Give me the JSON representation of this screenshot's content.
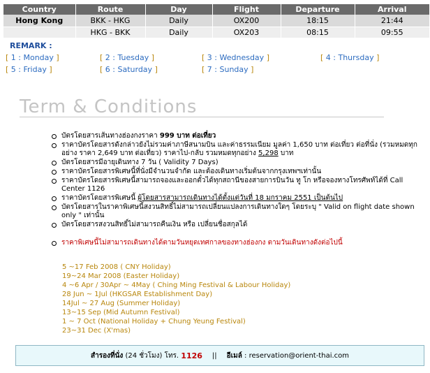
{
  "table": {
    "headers": [
      "Country",
      "Route",
      "Day",
      "Flight",
      "Departure",
      "Arrival"
    ],
    "rows": [
      {
        "country": "Hong Kong",
        "route": "BKK - HKG",
        "day": "Daily",
        "flight": "OX200",
        "departure": "18:15",
        "arrival": "21:44"
      },
      {
        "country": "",
        "route": "HKG - BKK",
        "day": "Daily",
        "flight": "OX203",
        "departure": "08:15",
        "arrival": "09:55"
      }
    ]
  },
  "remark": {
    "label": "REMARK :",
    "days": [
      {
        "open": "[",
        "text": " 1 : Monday ",
        "close": "]"
      },
      {
        "open": "[",
        "text": " 2 : Tuesday ",
        "close": "]"
      },
      {
        "open": "[",
        "text": " 3 : Wednesday ",
        "close": "]"
      },
      {
        "open": "[",
        "text": " 4 : Thursday ",
        "close": "]"
      },
      {
        "open": "[",
        "text": " 5 : Friday ",
        "close": "]"
      },
      {
        "open": "[",
        "text": " 6 : Saturday ",
        "close": "]"
      },
      {
        "open": "[",
        "text": " 7 : Sunday ",
        "close": "]"
      }
    ]
  },
  "conditions": {
    "title": "Term & Conditions",
    "items": [
      {
        "a": "บัตรโดยสารเส้นทางฮ่องกงราคา ",
        "b": "999 บาท ต่อเที่ยว",
        "c": ""
      },
      {
        "a": "ราคาบัตรโดยสารดังกล่าวยังไม่รวมค่าภาษีสนามบิน และค่าธรรมเนียม มูลค่า 1,650 บาท ต่อเที่ยว ต่อที่นั่ง (รวมหมดทุกอย่าง ราคา 2,649 บาท ต่อเที่ยว) ราคาไป-กลับ รวมหมดทุกอย่าง ",
        "u": "5,298",
        "c": " บาท"
      },
      {
        "a": "บัตรโดยสารมีอายุเดินทาง 7 วัน ( Validity 7 Days)"
      },
      {
        "a": "ราคาบัตรโดยสารพิเศษนี้ที่นั่งมีจำนวนจำกัด และต้องเดินทางเริ่มต้นจากกรุงเทพฯเท่านั้น"
      },
      {
        "a": "ราคาบัตรโดยสารพิเศษนี้สามารถจองและออกตั๋วได้ทุกสถานีของสายการบินวัน ทู โก หรือจองทางโทรศัพท์ได้ที่ Call Center 1126"
      },
      {
        "a": "ราคาบัตรโดยสารพิเศษนี้ ",
        "u": "ผู้โดยสารสามารถเดินทางได้ตั้งแต่วันที่ 18 มกราคม 2551 เป็นต้นไป",
        "c": ""
      },
      {
        "a": "บัตรโดยสารในราคาพิเศษนี้สงวนสิทธิ์ไม่สามารถเปลี่ยนแปลงการเดินทางใดๆ โดยระบุ \" Valid on flight date shown only \" เท่านั้น"
      },
      {
        "a": "บัตรโดยสารสงวนสิทธิ์ไม่สามารถคืนเงิน หรือ เปลี่ยนชื่อสกุลได้"
      }
    ],
    "holiday_note": "ราคาพิเศษนี้ไม่สามารถเดินทางได้ตามวันหยุดเทศกาลของทางฮ่องกง ตามวันเดินทางดังต่อไปนี้",
    "holidays": [
      "5 ~17 Feb 2008 ( CNY  Holiday)",
      "19~24 Mar 2008 (Easter Holiday)",
      "4 ~6 Apr / 30Apr ~ 4May ( Ching Ming Festival & Labour Holiday)",
      "28 Jun ~ 1Jul (HKGSAR Establishment Day)",
      "14Jul ~ 27 Aug (Summer Holiday)",
      "13~15 Sep (Mid Autumn Festival)",
      "1 ~ 7 Oct (National Holiday + Chung Yeung Festival)",
      "23~31 Dec (X'mas)"
    ]
  },
  "contact": {
    "reserve_label": "สำรองที่นั่ง",
    "hours": " (24 ชั่วโมง) โทร. ",
    "phone": "1126",
    "separator": "||",
    "email_label": "อีเมล์",
    "email_sep": " : ",
    "email": "reservation@orient-thai.com"
  },
  "colors": {
    "accent_blue": "#1f4e9c",
    "day_gold": "#b8860b",
    "warning_red": "#c00000",
    "header_gray": "#6a6a6a"
  }
}
